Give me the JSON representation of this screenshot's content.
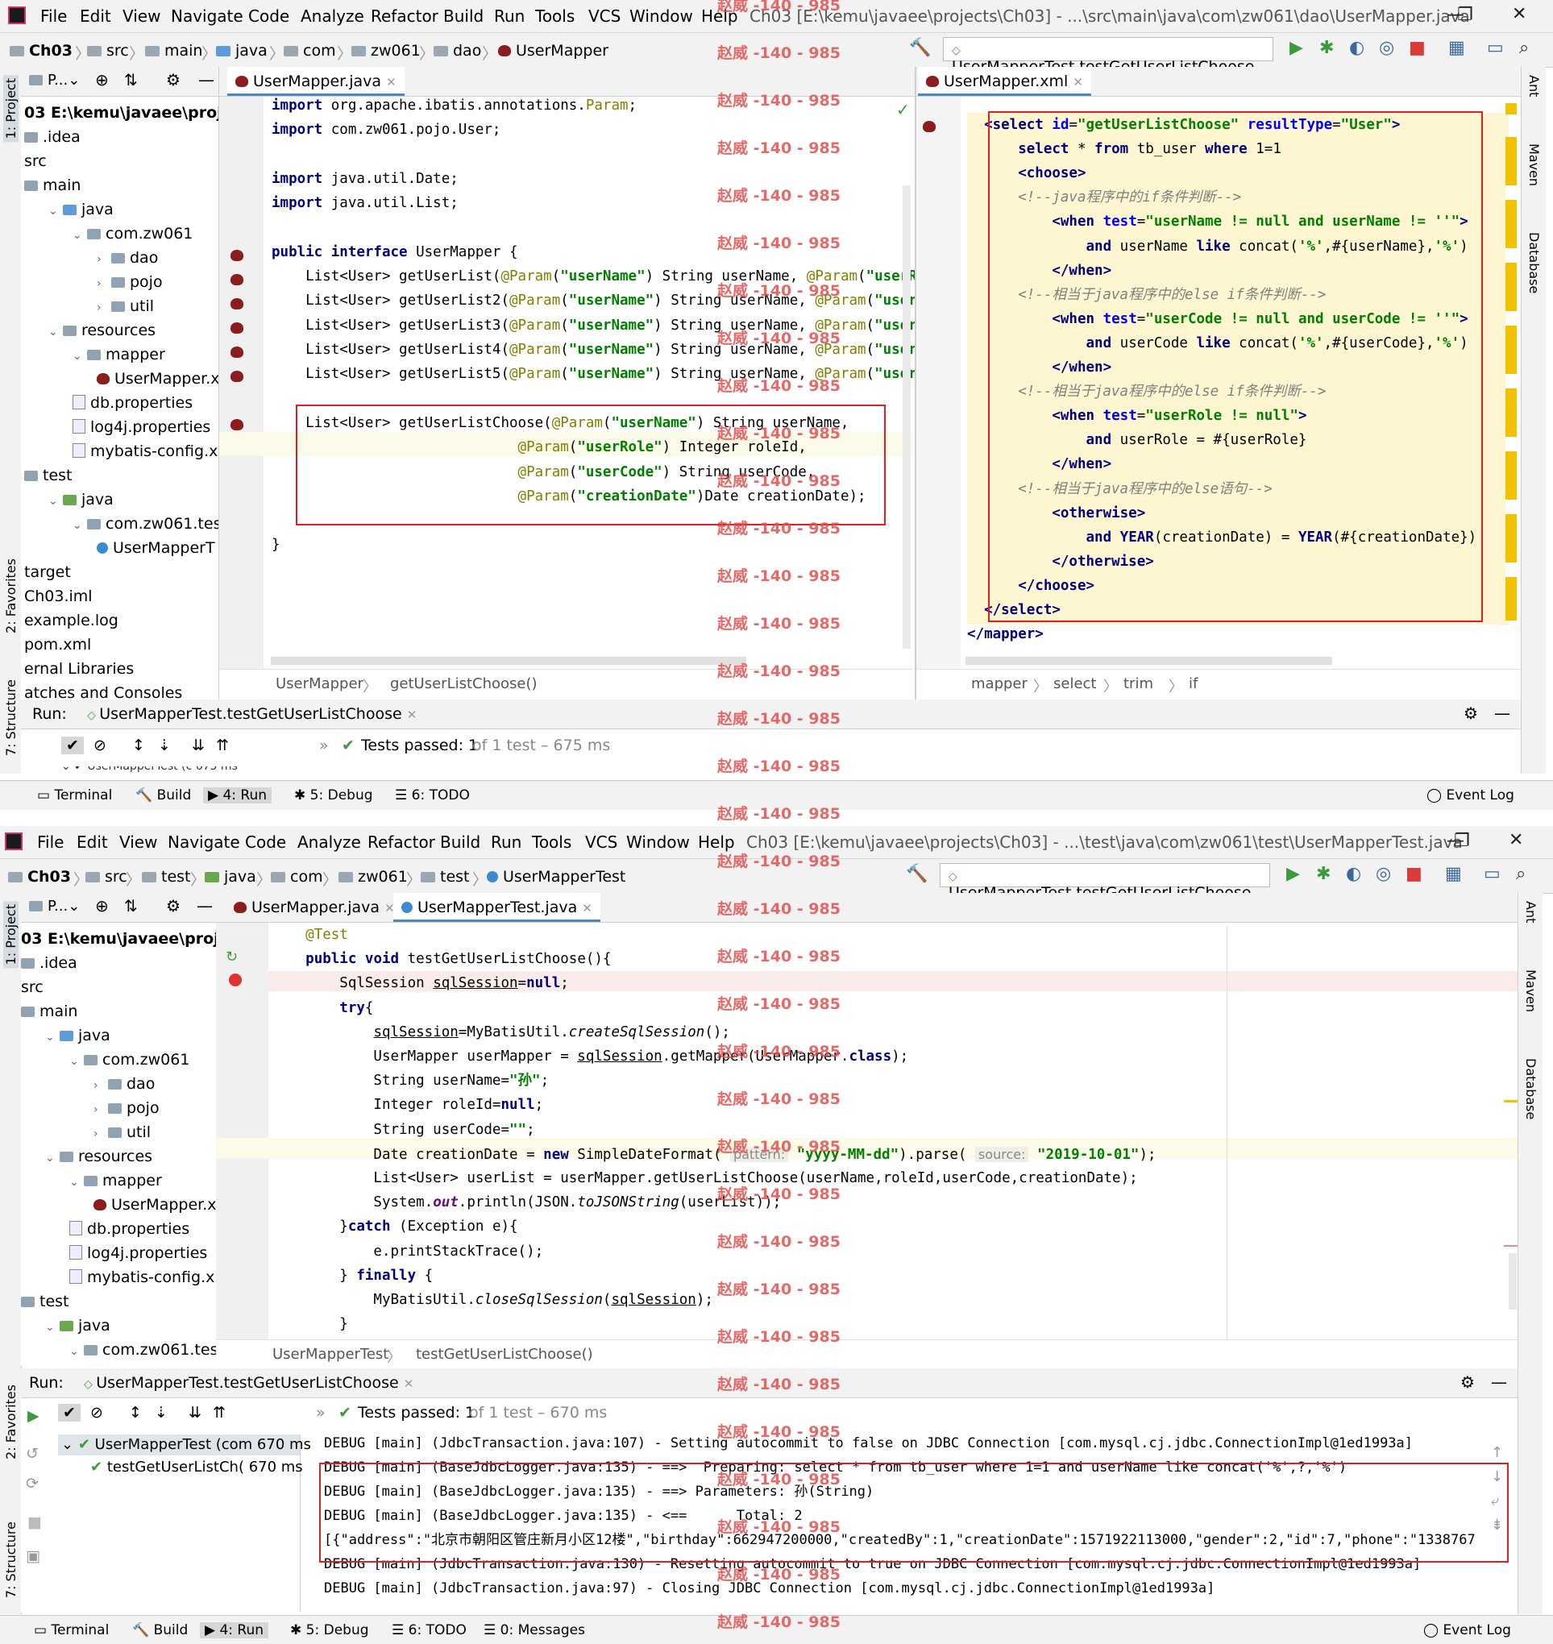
{
  "watermark": "赵威 -140 - 985",
  "menu": [
    "File",
    "Edit",
    "View",
    "Navigate",
    "Code",
    "Analyze",
    "Refactor",
    "Build",
    "Run",
    "Tools",
    "VCS",
    "Window",
    "Help"
  ],
  "top": {
    "title": "Ch03 [E:\\kemu\\javaee\\projects\\Ch03] - ...\\src\\main\\java\\com\\zw061\\dao\\UserMapper.java",
    "crumbs": [
      "Ch03",
      "src",
      "main",
      "java",
      "com",
      "zw061",
      "dao",
      "UserMapper"
    ],
    "run_config": "UserMapperTest.testGetUserListChoose",
    "project": {
      "header": "P...",
      "tree": [
        {
          "label": "03  E:\\kemu\\javaee\\projects\\",
          "depth": 0,
          "type": "root"
        },
        {
          "label": ".idea",
          "depth": 0,
          "type": "folder"
        },
        {
          "label": "src",
          "depth": 0,
          "type": "none"
        },
        {
          "label": "main",
          "depth": 0,
          "type": "folder"
        },
        {
          "label": "java",
          "depth": 1,
          "type": "src",
          "arrow": "v"
        },
        {
          "label": "com.zw061",
          "depth": 2,
          "type": "folder",
          "arrow": "v"
        },
        {
          "label": "dao",
          "depth": 3,
          "type": "folder",
          "arrow": ">"
        },
        {
          "label": "pojo",
          "depth": 3,
          "type": "folder",
          "arrow": ">"
        },
        {
          "label": "util",
          "depth": 3,
          "type": "folder",
          "arrow": ">"
        },
        {
          "label": "resources",
          "depth": 1,
          "type": "folder",
          "arrow": "v"
        },
        {
          "label": "mapper",
          "depth": 2,
          "type": "folder",
          "arrow": "v"
        },
        {
          "label": "UserMapper.x",
          "depth": 3,
          "type": "bird"
        },
        {
          "label": "db.properties",
          "depth": 2,
          "type": "file"
        },
        {
          "label": "log4j.properties",
          "depth": 2,
          "type": "file"
        },
        {
          "label": "mybatis-config.x",
          "depth": 2,
          "type": "file"
        },
        {
          "label": "test",
          "depth": 0,
          "type": "folder"
        },
        {
          "label": "java",
          "depth": 1,
          "type": "green",
          "arrow": "v"
        },
        {
          "label": "com.zw061.test",
          "depth": 2,
          "type": "folder",
          "arrow": "v"
        },
        {
          "label": "UserMapperT",
          "depth": 3,
          "type": "class"
        },
        {
          "label": "target",
          "depth": 0,
          "type": "none"
        },
        {
          "label": "Ch03.iml",
          "depth": 0,
          "type": "none"
        },
        {
          "label": "example.log",
          "depth": 0,
          "type": "none"
        },
        {
          "label": "pom.xml",
          "depth": 0,
          "type": "none"
        },
        {
          "label": "ernal Libraries",
          "depth": 0,
          "type": "none"
        },
        {
          "label": "atches and Consoles",
          "depth": 0,
          "type": "none"
        }
      ]
    },
    "java_tab": "UserMapper.java",
    "xml_tab": "UserMapper.xml",
    "java_breadcrumb": [
      "UserMapper",
      "getUserListChoose()"
    ],
    "xml_breadcrumb": [
      "mapper",
      "select",
      "trim",
      "if"
    ],
    "run_label": "Run:",
    "run_tab": "UserMapperTest.testGetUserListChoose",
    "tests_passed": "Tests passed: 1",
    "tests_detail": "of 1 test – 675 ms",
    "tree_row": "UserMapperTest (c 675 ms",
    "status": [
      "Terminal",
      "Build",
      "4: Run",
      "5: Debug",
      "6: TODO"
    ],
    "event_log": "Event Log",
    "right_tools": [
      "Ant",
      "Maven",
      "Database"
    ],
    "left_tools": [
      "1: Project",
      "2: Favorites",
      "7: Structure"
    ]
  },
  "bottom": {
    "title": "Ch03 [E:\\kemu\\javaee\\projects\\Ch03] - ...\\test\\java\\com\\zw061\\test\\UserMapperTest.java",
    "crumbs": [
      "Ch03",
      "src",
      "test",
      "java",
      "com",
      "zw061",
      "test",
      "UserMapperTest"
    ],
    "run_config": "UserMapperTest.testGetUserListChoose",
    "project": {
      "header": "P...",
      "tree": [
        {
          "label": "03  E:\\kemu\\javaee\\projects\\",
          "depth": 0,
          "type": "root"
        },
        {
          "label": ".idea",
          "depth": 0,
          "type": "folder"
        },
        {
          "label": "src",
          "depth": 0,
          "type": "none"
        },
        {
          "label": "main",
          "depth": 0,
          "type": "folder"
        },
        {
          "label": "java",
          "depth": 1,
          "type": "src",
          "arrow": "v"
        },
        {
          "label": "com.zw061",
          "depth": 2,
          "type": "folder",
          "arrow": "v"
        },
        {
          "label": "dao",
          "depth": 3,
          "type": "folder",
          "arrow": ">"
        },
        {
          "label": "pojo",
          "depth": 3,
          "type": "folder",
          "arrow": ">"
        },
        {
          "label": "util",
          "depth": 3,
          "type": "folder",
          "arrow": ">"
        },
        {
          "label": "resources",
          "depth": 1,
          "type": "folder",
          "arrow": "v"
        },
        {
          "label": "mapper",
          "depth": 2,
          "type": "folder",
          "arrow": "v"
        },
        {
          "label": "UserMapper.x",
          "depth": 3,
          "type": "bird"
        },
        {
          "label": "db.properties",
          "depth": 2,
          "type": "file"
        },
        {
          "label": "log4j.properties",
          "depth": 2,
          "type": "file"
        },
        {
          "label": "mybatis-config.x",
          "depth": 2,
          "type": "file"
        },
        {
          "label": "test",
          "depth": 0,
          "type": "folder"
        },
        {
          "label": "java",
          "depth": 1,
          "type": "green",
          "arrow": "v"
        },
        {
          "label": "com.zw061.test",
          "depth": 2,
          "type": "folder",
          "arrow": "v"
        }
      ]
    },
    "tabs": [
      "UserMapper.java",
      "UserMapperTest.java"
    ],
    "breadcrumb": [
      "UserMapperTest",
      "testGetUserListChoose()"
    ],
    "run_label": "Run:",
    "run_tab": "UserMapperTest.testGetUserListChoose",
    "tests_passed": "Tests passed: 1",
    "tests_detail": "of 1 test – 670 ms",
    "tree_rows": [
      "UserMapperTest (com 670 ms",
      "testGetUserListCh( 670 ms"
    ],
    "console": [
      "DEBUG [main] (JdbcTransaction.java:107) - Setting autocommit to false on JDBC Connection [com.mysql.cj.jdbc.ConnectionImpl@1ed1993a]",
      "DEBUG [main] (BaseJdbcLogger.java:135) - ==>  Preparing: select * from tb_user where 1=1 and userName like concat('%',?,'%')",
      "DEBUG [main] (BaseJdbcLogger.java:135) - ==> Parameters: 孙(String)",
      "DEBUG [main] (BaseJdbcLogger.java:135) - <==      Total: 2",
      "[{\"address\":\"北京市朝阳区管庄新月小区12楼\",\"birthday\":662947200000,\"createdBy\":1,\"creationDate\":1571922113000,\"gender\":2,\"id\":7,\"phone\":\"1338767",
      "DEBUG [main] (JdbcTransaction.java:130) - Resetting autocommit to true on JDBC Connection [com.mysql.cj.jdbc.ConnectionImpl@1ed1993a]",
      "DEBUG [main] (JdbcTransaction.java:97) - Closing JDBC Connection [com.mysql.cj.jdbc.ConnectionImpl@1ed1993a]"
    ],
    "status": [
      "Terminal",
      "Build",
      "4: Run",
      "5: Debug",
      "6: TODO",
      "0: Messages"
    ],
    "event_log": "Event Log",
    "right_tools": [
      "Ant",
      "Maven",
      "Database"
    ],
    "left_tools": [
      "1: Project",
      "2: Favorites",
      "7: Structure"
    ]
  }
}
